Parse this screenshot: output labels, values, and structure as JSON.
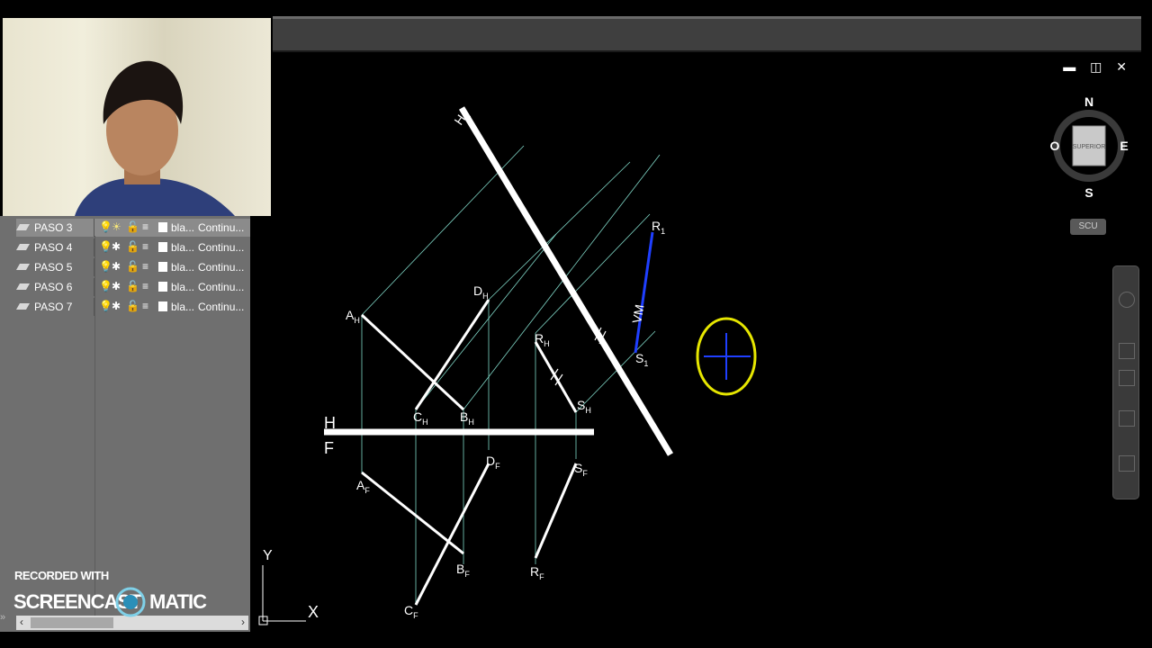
{
  "window_controls": "▬ ◫ ✕",
  "layers": [
    {
      "name": "PASO 3",
      "color": "bla...",
      "linetype": "Continu...",
      "selected": true
    },
    {
      "name": "PASO 4",
      "color": "bla...",
      "linetype": "Continu...",
      "selected": false
    },
    {
      "name": "PASO 5",
      "color": "bla...",
      "linetype": "Continu...",
      "selected": false
    },
    {
      "name": "PASO 6",
      "color": "bla...",
      "linetype": "Continu...",
      "selected": false
    },
    {
      "name": "PASO 7",
      "color": "bla...",
      "linetype": "Continu...",
      "selected": false
    }
  ],
  "viewcube": {
    "north": "N",
    "south": "S",
    "east": "E",
    "west": "O",
    "face": "SUPERIOR"
  },
  "scu_label": "SCU",
  "watermark": {
    "line1": "RECORDED WITH",
    "brand_left": "SCREENCAST",
    "brand_right": "MATIC"
  },
  "ucs": {
    "y": "Y",
    "x": "X"
  },
  "drawing": {
    "h_label": "H",
    "f_label": "F",
    "h1_label": "H",
    "h1_sub": "1",
    "vm_label": "VM",
    "points": [
      {
        "base": "A",
        "sub": "H"
      },
      {
        "base": "D",
        "sub": "H"
      },
      {
        "base": "R",
        "sub": "H"
      },
      {
        "base": "C",
        "sub": "H"
      },
      {
        "base": "B",
        "sub": "H"
      },
      {
        "base": "S",
        "sub": "H"
      },
      {
        "base": "A",
        "sub": "F"
      },
      {
        "base": "D",
        "sub": "F"
      },
      {
        "base": "S",
        "sub": "F"
      },
      {
        "base": "B",
        "sub": "F"
      },
      {
        "base": "R",
        "sub": "F"
      },
      {
        "base": "C",
        "sub": "F"
      },
      {
        "base": "R",
        "sub": "1"
      },
      {
        "base": "S",
        "sub": "1"
      }
    ],
    "colors": {
      "line": "#ffffff",
      "projector": "#7fd6c6",
      "true_length": "#1f3fff",
      "cursor": "#e6e600"
    }
  },
  "icons": [
    "layer-icon",
    "lightbulb-icon",
    "sun-freeze-icon",
    "lock-icon",
    "print-icon"
  ]
}
